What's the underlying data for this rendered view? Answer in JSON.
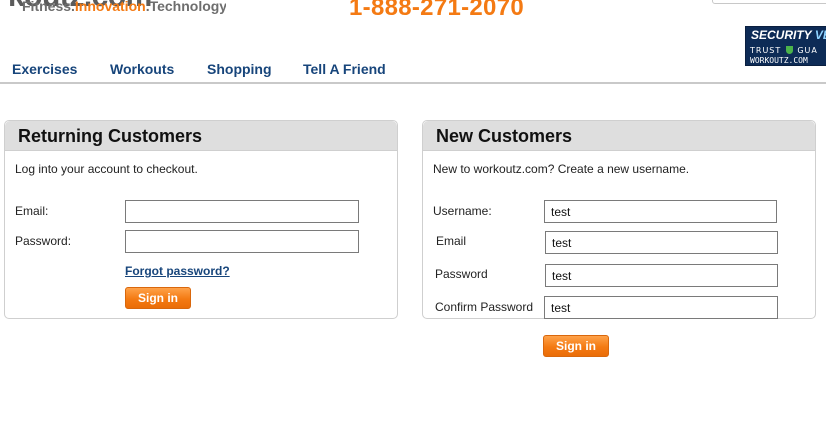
{
  "header": {
    "logo": {
      "wordmark_a": "koutz",
      "wordmark_b": ".com",
      "tagline_a": "Fitness.",
      "tagline_b": "Innovation",
      "tagline_c": ".Technology"
    },
    "phone": "1-888-271-2070",
    "security_seal": {
      "line1": "SECURITY",
      "line1_cut": "VER",
      "line2a": "TRUST",
      "line2b": "GUA",
      "line3": "WORKOUTZ.COM"
    }
  },
  "nav": {
    "items": [
      {
        "label": "Exercises"
      },
      {
        "label": "Workouts"
      },
      {
        "label": "Shopping"
      },
      {
        "label": "Tell A Friend"
      }
    ]
  },
  "returning": {
    "title": "Returning Customers",
    "intro": "Log into your account to checkout.",
    "email_label": "Email:",
    "email_value": "",
    "password_label": "Password:",
    "password_value": "",
    "forgot_label": "Forgot password?",
    "signin_label": "Sign in"
  },
  "new_customers": {
    "title": "New Customers",
    "intro": "New to workoutz.com? Create a new username.",
    "username_label": "Username:",
    "username_value": "test",
    "email_label": "Email",
    "email_value": "test",
    "password_label": "Password",
    "password_value": "test",
    "confirm_label": "Confirm Password",
    "confirm_value": "test",
    "signin_label": "Sign in"
  },
  "colors": {
    "accent": "#f47a13",
    "nav_link": "#17457b",
    "panel_header": "#dedede",
    "seal_bg": "#0d2b56"
  }
}
